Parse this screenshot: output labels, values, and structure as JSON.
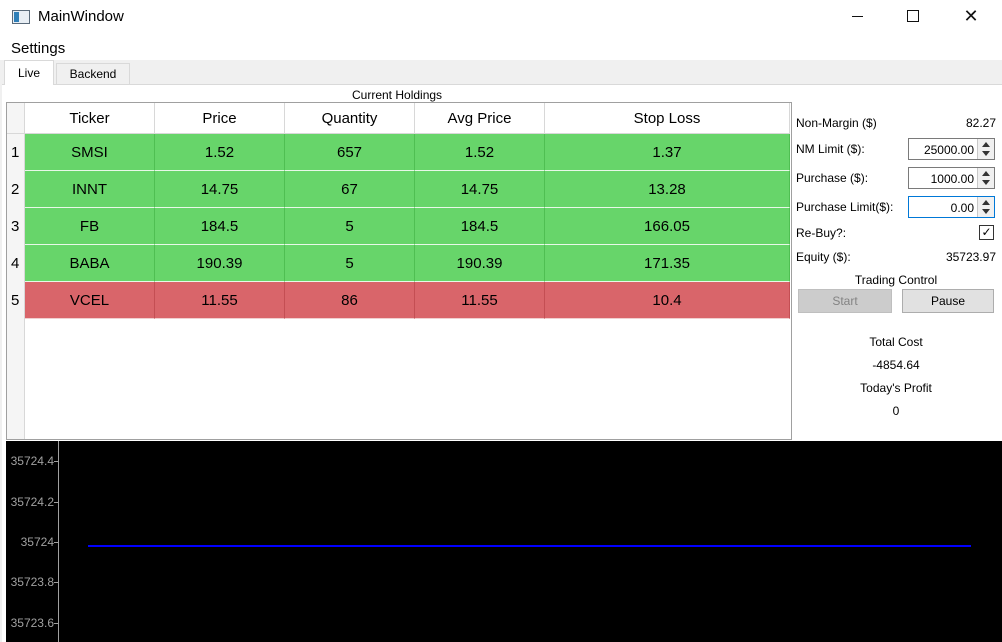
{
  "window": {
    "title": "MainWindow"
  },
  "menu": {
    "settings": "Settings"
  },
  "tabs": [
    {
      "label": "Live"
    },
    {
      "label": "Backend"
    }
  ],
  "holdings": {
    "title": "Current Holdings",
    "columns": [
      "Ticker",
      "Price",
      "Quantity",
      "Avg Price",
      "Stop Loss"
    ],
    "rows": [
      {
        "num": "1",
        "status": "green",
        "cells": [
          "SMSI",
          "1.52",
          "657",
          "1.52",
          "1.37"
        ]
      },
      {
        "num": "2",
        "status": "green",
        "cells": [
          "INNT",
          "14.75",
          "67",
          "14.75",
          "13.28"
        ]
      },
      {
        "num": "3",
        "status": "green",
        "cells": [
          "FB",
          "184.5",
          "5",
          "184.5",
          "166.05"
        ]
      },
      {
        "num": "4",
        "status": "green",
        "cells": [
          "BABA",
          "190.39",
          "5",
          "190.39",
          "171.35"
        ]
      },
      {
        "num": "5",
        "status": "red",
        "cells": [
          "VCEL",
          "11.55",
          "86",
          "11.55",
          "10.4"
        ]
      }
    ],
    "colors": {
      "green": "#67d56a",
      "red": "#d9656a"
    }
  },
  "side": {
    "non_margin_label": "Non-Margin ($)",
    "non_margin_value": "82.27",
    "nm_limit_label": "NM Limit ($):",
    "nm_limit_value": "25000.00",
    "purchase_label": "Purchase ($):",
    "purchase_value": "1000.00",
    "purchase_limit_label": "Purchase Limit($):",
    "purchase_limit_value": "0.00",
    "rebuy_label": "Re-Buy?:",
    "rebuy_checked": "✓",
    "equity_label": "Equity ($):",
    "equity_value": "35723.97",
    "trading_control_label": "Trading Control",
    "start_label": "Start",
    "pause_label": "Pause",
    "total_cost_label": "Total Cost",
    "total_cost_value": "-4854.64",
    "todays_profit_label": "Today's Profit",
    "todays_profit_value": "0"
  },
  "chart_data": {
    "type": "line",
    "ylim": [
      35723.5,
      35724.5
    ],
    "yticks": [
      "35724.4",
      "35724.2",
      "35724",
      "35723.8",
      "35723.6"
    ],
    "ytick_values": [
      35724.4,
      35724.2,
      35724.0,
      35723.8,
      35723.6
    ],
    "series": [
      {
        "values": [
          35723.98,
          35723.98
        ],
        "color": "#0000ff"
      }
    ],
    "background": "#000000"
  }
}
